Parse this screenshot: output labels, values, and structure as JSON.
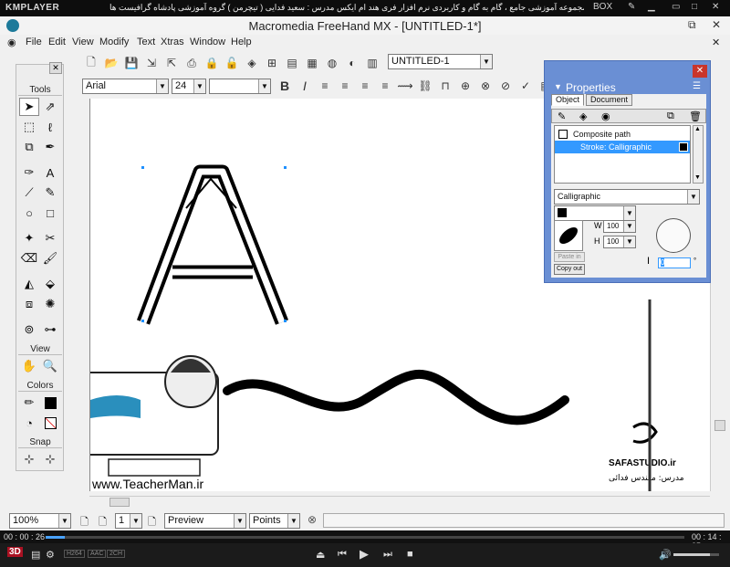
{
  "player": {
    "logo": "KMPLAYER",
    "title": "مجموعه آموزشی جامع ، گام به گام و کاربردی نرم افزار فری هند ام ایکس   مدرس : سعید فدایی ( تیچرمن ) گروه آموزشی پادشاه گرافیست ها",
    "box_label": "BOX",
    "time_elapsed": "00 : 00 : 26",
    "time_total": "00 : 14 : 35",
    "progress_fraction": 0.03,
    "volume_fraction": 0.8,
    "badges": [
      "3D",
      "H264",
      "AAC",
      "2CH"
    ]
  },
  "app": {
    "title": "Macromedia FreeHand MX - [UNTITLED-1*]",
    "menu": [
      "File",
      "Edit",
      "View",
      "Modify",
      "Text",
      "Xtras",
      "Window",
      "Help"
    ],
    "doc_select": "UNTITLED-1",
    "font_name": "Arial",
    "font_size": "24",
    "font_style": "",
    "tools_title": "Tools",
    "view_title": "View",
    "colors_title": "Colors",
    "snap_title": "Snap",
    "zoom": "100%",
    "page_number": "1",
    "view_mode": "Preview",
    "units": "Points"
  },
  "properties": {
    "title": "Properties",
    "tabs": [
      "Object",
      "Document"
    ],
    "list": [
      "Composite path",
      "Stroke: Calligraphic"
    ],
    "stroke_type": "Calligraphic",
    "w_label": "W",
    "w_value": "100",
    "h_label": "H",
    "h_value": "100",
    "paste_in": "Paste in",
    "copy_out": "Copy out",
    "angle_value": "0"
  },
  "watermark": {
    "url": "www.TeacherMan.ir",
    "studio": "SAFASTUDIO.ir",
    "teacher_label": "مدرس: مهندس فدائی"
  },
  "colors": {
    "kmp_bg": "#0d0d0d",
    "accent": "#6a8fd4",
    "selection": "#3399ff"
  }
}
